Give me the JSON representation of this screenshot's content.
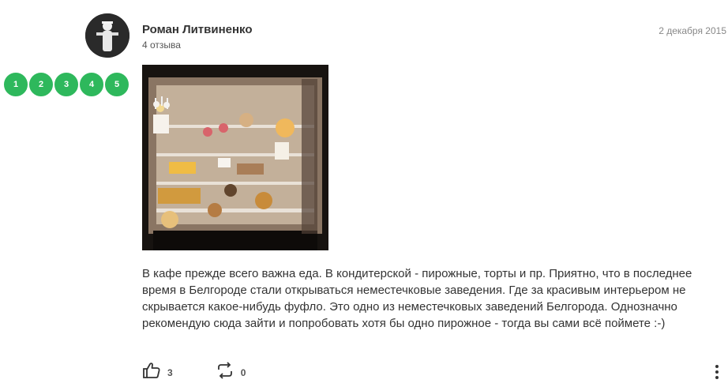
{
  "review": {
    "author": "Роман Литвиненко",
    "review_count": "4 отзыва",
    "date": "2 декабря 2015",
    "rating_labels": [
      "1",
      "2",
      "3",
      "4",
      "5"
    ],
    "text": "В кафе прежде всего важна еда. В кондитерской - пирожные, торты и пр. Приятно, что в последнее время в Белгороде стали открываться неместечковые заведения. Где за красивым интерьером не скрывается какое-нибудь фуфло. Это одно из неместечковых заведений Белгорода. Однозначно рекомендую сюда зайти и попробовать хотя бы одно пирожное - тогда вы сами всё поймете :-)",
    "likes": "3",
    "reposts": "0"
  },
  "colors": {
    "rating_green": "#2eb85c",
    "text": "#333333",
    "muted": "#888888"
  },
  "icons": [
    "like-icon",
    "repost-icon",
    "more-icon"
  ]
}
